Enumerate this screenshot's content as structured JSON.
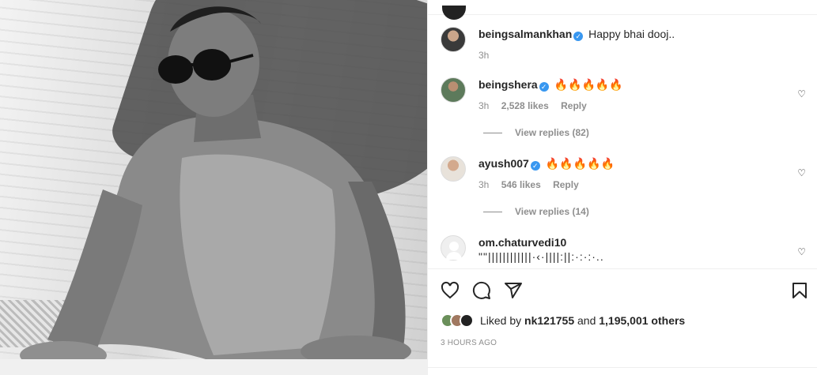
{
  "post": {
    "caption_user": "beingsalmankhan",
    "caption_text": "Happy bhai dooj..",
    "caption_time": "3h"
  },
  "comments": [
    {
      "user": "beingshera",
      "text": "🔥🔥🔥🔥🔥",
      "time": "3h",
      "likes": "2,528 likes",
      "reply_label": "Reply",
      "view_replies": "View replies (82)"
    },
    {
      "user": "ayush007",
      "text": "🔥🔥🔥🔥🔥",
      "time": "3h",
      "likes": "546 likes",
      "reply_label": "Reply",
      "view_replies": "View replies (14)"
    },
    {
      "user": "om.chaturvedi10",
      "text": "\"\"||||||||||||·‹·||||:||:·:·:·.."
    }
  ],
  "footer": {
    "liked_by_prefix": "Liked by",
    "liked_by_user": "nk121755",
    "liked_by_and": "and",
    "liked_by_others": "1,195,001 others",
    "timestamp": "3 HOURS AGO"
  },
  "icons": {
    "like": "heart-icon",
    "comment": "comment-icon",
    "share": "share-icon",
    "save": "bookmark-icon",
    "verified": "verified-badge-icon"
  },
  "colors": {
    "verified": "#3897f0",
    "muted": "#8e8e8e",
    "text": "#262626",
    "divider": "#efefef"
  }
}
